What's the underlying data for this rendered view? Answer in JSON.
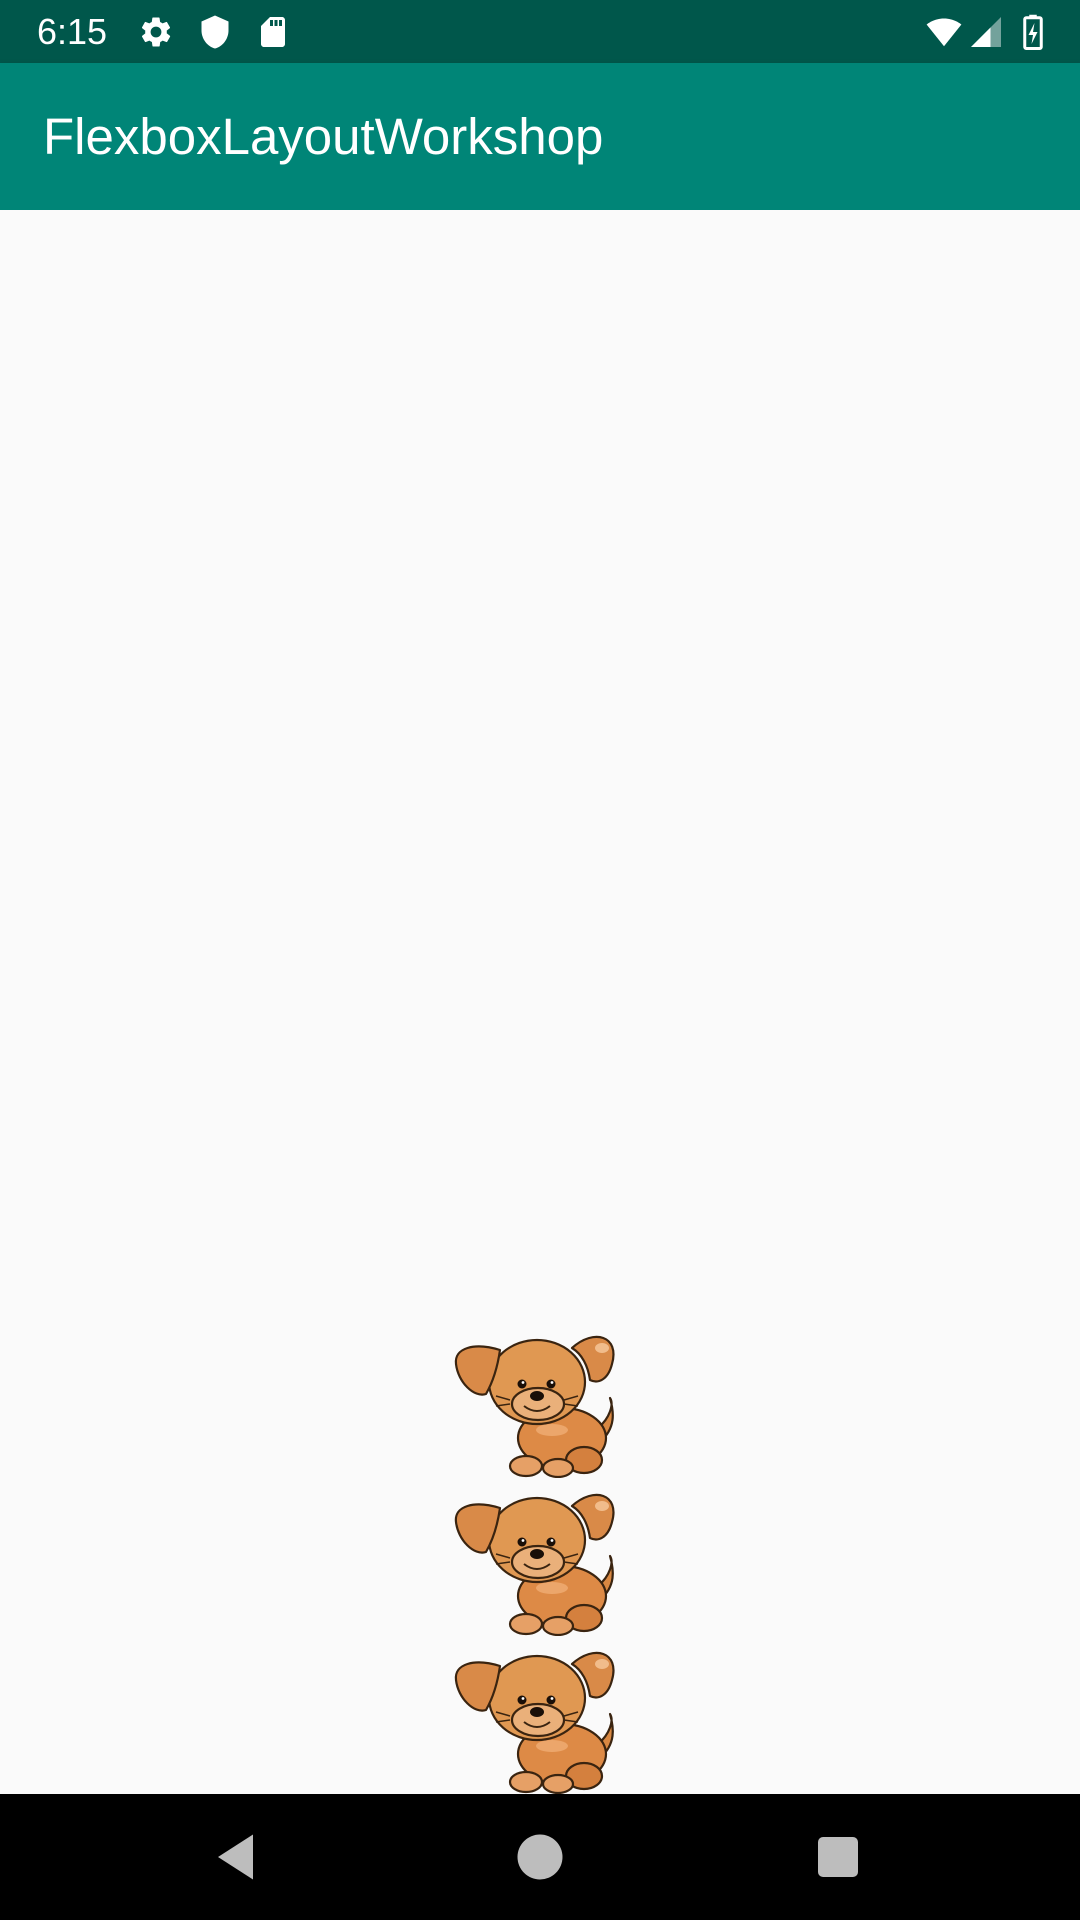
{
  "status_bar": {
    "time": "6:15",
    "left_icons": [
      "settings-icon",
      "shield-icon",
      "sd-card-icon"
    ],
    "right_icons": [
      "wifi-icon",
      "cell-signal-icon",
      "battery-charging-icon"
    ]
  },
  "app_bar": {
    "title": "FlexboxLayoutWorkshop"
  },
  "content": {
    "puppies": [
      {
        "icon": "puppy-image"
      },
      {
        "icon": "puppy-image"
      },
      {
        "icon": "puppy-image"
      }
    ]
  },
  "nav_bar": {
    "buttons": [
      "back-icon",
      "home-icon",
      "recents-icon"
    ]
  },
  "colors": {
    "status_bar": "#00574b",
    "app_bar": "#008577",
    "background": "#fafafa",
    "nav_bar": "#000000"
  }
}
